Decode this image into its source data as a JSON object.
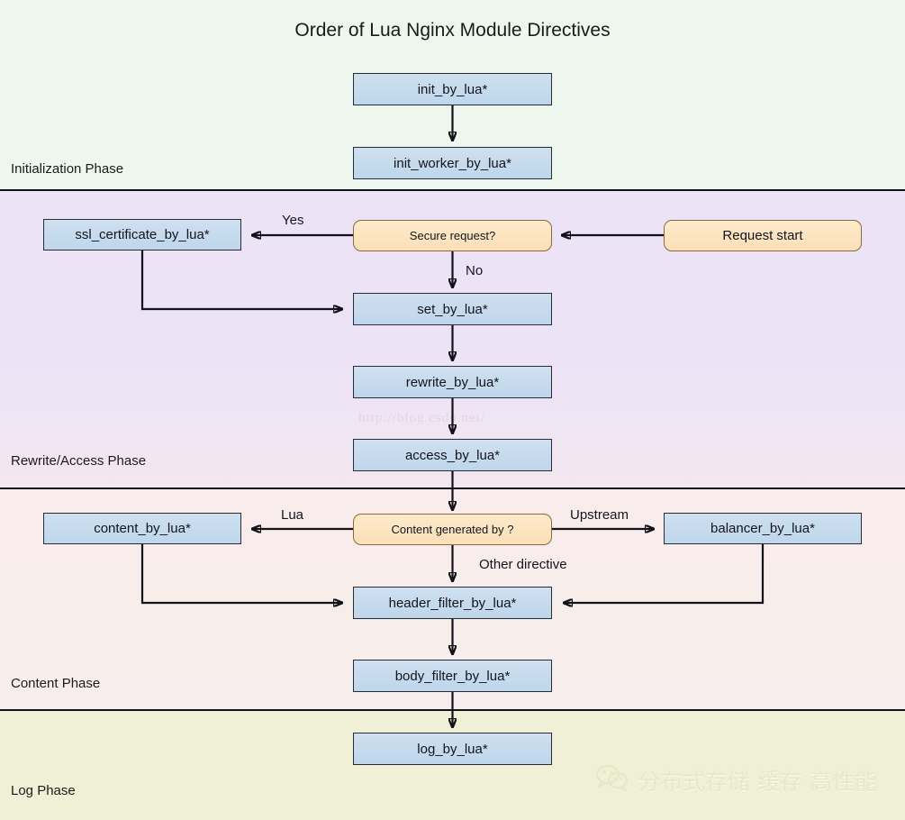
{
  "title": "Order of Lua Nginx Module Directives",
  "watermarks": {
    "url": "http://blog.csdn.net/",
    "wechat_text": "分布式存储 缓存 高性能",
    "wechat_icon": "wechat-icon"
  },
  "phases": [
    {
      "id": "initialization",
      "label": "Initialization Phase",
      "color": "#eef7ee"
    },
    {
      "id": "rewrite_access",
      "label": "Rewrite/Access Phase",
      "color": "#ece3f7"
    },
    {
      "id": "content",
      "label": "Content Phase",
      "color": "#f8ecec"
    },
    {
      "id": "log",
      "label": "Log Phase",
      "color": "#f0f0d6"
    }
  ],
  "nodes": [
    {
      "id": "init_by_lua",
      "label": "init_by_lua*",
      "kind": "process"
    },
    {
      "id": "init_worker_by_lua",
      "label": "init_worker_by_lua*",
      "kind": "process"
    },
    {
      "id": "request_start",
      "label": "Request start",
      "kind": "terminator"
    },
    {
      "id": "secure_request",
      "label": "Secure request?",
      "kind": "decision"
    },
    {
      "id": "ssl_certificate",
      "label": "ssl_certificate_by_lua*",
      "kind": "process"
    },
    {
      "id": "set_by_lua",
      "label": "set_by_lua*",
      "kind": "process"
    },
    {
      "id": "rewrite_by_lua",
      "label": "rewrite_by_lua*",
      "kind": "process"
    },
    {
      "id": "access_by_lua",
      "label": "access_by_lua*",
      "kind": "process"
    },
    {
      "id": "content_generated",
      "label": "Content generated by ?",
      "kind": "decision"
    },
    {
      "id": "content_by_lua",
      "label": "content_by_lua*",
      "kind": "process"
    },
    {
      "id": "balancer_by_lua",
      "label": "balancer_by_lua*",
      "kind": "process"
    },
    {
      "id": "header_filter",
      "label": "header_filter_by_lua*",
      "kind": "process"
    },
    {
      "id": "body_filter",
      "label": "body_filter_by_lua*",
      "kind": "process"
    },
    {
      "id": "log_by_lua",
      "label": "log_by_lua*",
      "kind": "process"
    }
  ],
  "edge_labels": {
    "yes": "Yes",
    "no": "No",
    "lua": "Lua",
    "upstream": "Upstream",
    "other_directive": "Other directive"
  },
  "colors": {
    "process_fill": "#c5d9ed",
    "decision_fill": "#fbe1ba",
    "node_border": "#2b2b38",
    "decision_border": "#8a6a3c",
    "connector": "#12121a"
  }
}
